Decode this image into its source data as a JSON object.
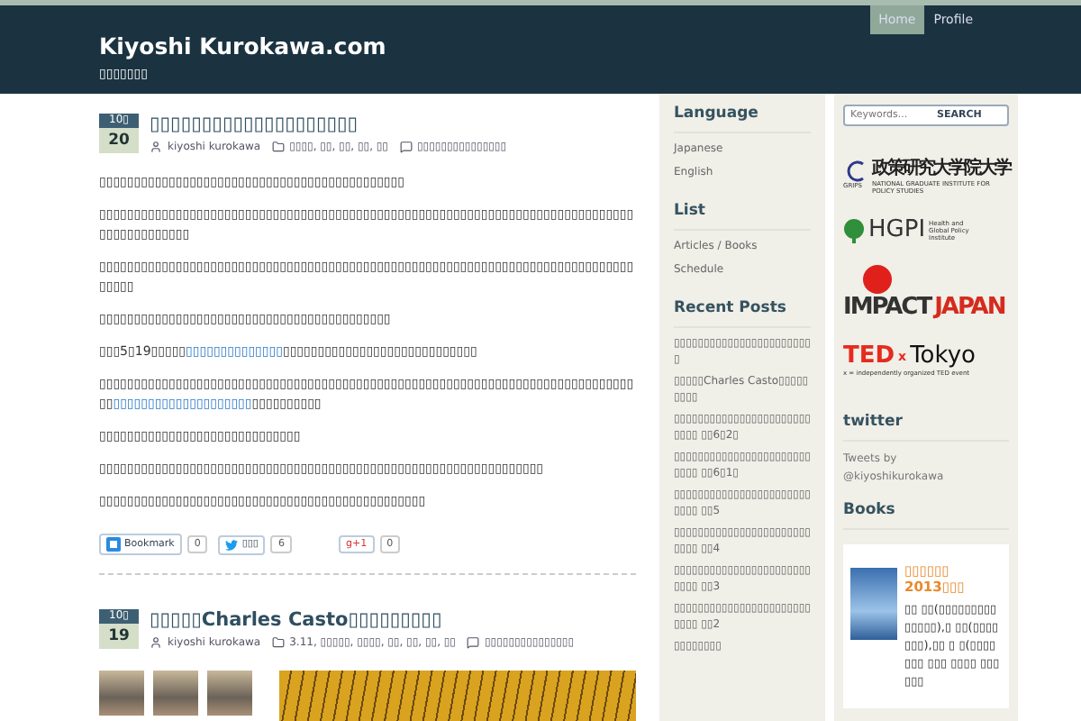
{
  "header": {
    "title": "Kiyoshi Kurokawa.com",
    "tagline": "▯▯▯▯▯▯▯"
  },
  "nav": [
    {
      "label": "Home",
      "selected": true
    },
    {
      "label": "Profile",
      "selected": false
    }
  ],
  "posts": [
    {
      "month": "10▯",
      "day": "20",
      "title": "▯▯▯▯▯▯▯▯▯▯▯▯▯▯▯▯▯▯▯▯",
      "author": "kiyoshi kurokawa",
      "categories": "▯▯▯▯, ▯▯, ▯▯, ▯▯, ▯▯",
      "comments": "▯▯▯▯▯▯▯▯▯▯▯▯▯▯▯",
      "paragraphs": [
        [
          {
            "text": "▯▯▯▯▯▯▯▯▯▯▯▯▯▯▯▯▯▯▯▯▯▯▯▯▯▯▯▯▯▯▯▯▯▯▯▯▯▯▯▯▯▯▯▯",
            "link": false
          }
        ],
        [
          {
            "text": "▯▯▯▯▯▯▯▯▯▯▯▯▯▯▯▯▯▯▯▯▯▯▯▯▯▯▯▯▯▯▯▯▯▯▯▯▯▯▯▯▯▯▯▯▯▯▯▯▯▯▯▯▯▯▯▯▯▯▯▯▯▯▯▯▯▯▯▯▯▯▯▯▯▯▯▯▯▯▯▯▯▯▯▯▯▯▯▯▯▯",
            "link": false
          }
        ],
        [
          {
            "text": "▯▯▯▯▯▯▯▯▯▯▯▯▯▯▯▯▯▯▯▯▯▯▯▯▯▯▯▯▯▯▯▯▯▯▯▯▯▯▯▯▯▯▯▯▯▯▯▯▯▯▯▯▯▯▯▯▯▯▯▯▯▯▯▯▯▯▯▯▯▯▯▯▯▯▯▯▯▯▯▯▯▯",
            "link": false
          }
        ],
        [
          {
            "text": "▯▯▯▯▯▯▯▯▯▯▯▯▯▯▯▯▯▯▯▯▯▯▯▯▯▯▯▯▯▯▯▯▯▯▯▯▯▯▯▯▯▯",
            "link": false
          }
        ],
        [
          {
            "text": "▯▯▯5▯19▯▯▯▯▯",
            "link": false
          },
          {
            "text": "▯▯▯▯▯▯▯▯▯▯▯▯▯▯",
            "link": true
          },
          {
            "text": "▯▯▯▯▯▯▯▯▯▯▯▯▯▯▯▯▯▯▯▯▯▯▯▯▯▯▯▯",
            "link": false
          }
        ],
        [
          {
            "text": "▯▯▯▯▯▯▯▯▯▯▯▯▯▯▯▯▯▯▯▯▯▯▯▯▯▯▯▯▯▯▯▯▯▯▯▯▯▯▯▯▯▯▯▯▯▯▯▯▯▯▯▯▯▯▯▯▯▯▯▯▯▯▯▯▯▯▯▯▯▯▯▯▯▯▯▯▯▯▯",
            "link": false
          },
          {
            "text": "▯▯▯▯▯▯▯▯▯▯▯▯▯▯▯▯▯▯▯▯",
            "link": true
          },
          {
            "text": "▯▯▯▯▯▯▯▯▯▯",
            "link": false
          }
        ],
        [
          {
            "text": "▯▯▯▯▯▯▯▯▯▯▯▯▯▯▯▯▯▯▯▯▯▯▯▯▯▯▯▯▯",
            "link": false
          }
        ],
        [
          {
            "text": "▯▯▯▯▯▯▯▯▯▯▯▯▯▯▯▯▯▯▯▯▯▯▯▯▯▯▯▯▯▯▯▯▯▯▯▯▯▯▯▯▯▯▯▯▯▯▯▯▯▯▯▯▯▯▯▯▯▯▯▯▯▯▯▯",
            "link": false
          }
        ],
        [
          {
            "text": "▯▯▯▯▯▯▯▯▯▯▯▯▯▯▯▯▯▯▯▯▯▯▯▯▯▯▯▯▯▯▯▯▯▯▯▯▯▯▯▯▯▯▯▯▯▯▯",
            "link": false
          }
        ]
      ],
      "share": [
        {
          "kind": "hatena",
          "label": "Bookmark",
          "count": "0"
        },
        {
          "kind": "twitter",
          "label": "▯▯▯",
          "count": "6"
        },
        {
          "kind": "gplus",
          "label": "g+1",
          "count": "0"
        }
      ]
    },
    {
      "month": "10▯",
      "day": "19",
      "title": "▯▯▯▯▯Charles Casto▯▯▯▯▯▯▯▯▯",
      "author": "kiyoshi kurokawa",
      "categories": "3.11, ▯▯▯▯▯, ▯▯▯▯, ▯▯, ▯▯, ▯▯, ▯▯",
      "comments": "▯▯▯▯▯▯▯▯▯▯▯▯▯▯▯",
      "photos": [
        {
          "kind": "thumb"
        },
        {
          "kind": "thumb"
        },
        {
          "kind": "thumb"
        },
        {
          "kind": "wide"
        }
      ]
    }
  ],
  "sidebar": [
    {
      "heading": "Language",
      "items": [
        "Japanese",
        "English"
      ]
    },
    {
      "heading": "List",
      "items": [
        "Articles / Books",
        "Schedule"
      ]
    },
    {
      "heading": "Recent Posts",
      "items": [
        "▯▯▯▯▯▯▯▯▯▯▯▯▯▯▯▯▯▯▯▯▯▯▯▯",
        "▯▯▯▯▯Charles Casto▯▯▯▯▯▯▯▯▯",
        "▯▯▯▯▯▯▯▯▯▯▯▯▯▯▯▯▯▯▯▯▯▯▯▯▯▯▯ ▯▯6▯2▯",
        "▯▯▯▯▯▯▯▯▯▯▯▯▯▯▯▯▯▯▯▯▯▯▯▯▯▯▯ ▯▯6▯1▯",
        "▯▯▯▯▯▯▯▯▯▯▯▯▯▯▯▯▯▯▯▯▯▯▯▯▯▯▯ ▯▯5",
        "▯▯▯▯▯▯▯▯▯▯▯▯▯▯▯▯▯▯▯▯▯▯▯▯▯▯▯ ▯▯4",
        "▯▯▯▯▯▯▯▯▯▯▯▯▯▯▯▯▯▯▯▯▯▯▯▯▯▯▯ ▯▯3",
        "▯▯▯▯▯▯▯▯▯▯▯▯▯▯▯▯▯▯▯▯▯▯▯▯▯▯▯ ▯▯2",
        "▯▯▯▯▯▯▯▯"
      ]
    }
  ],
  "search": {
    "placeholder": "Keywords...",
    "button": "SEARCH"
  },
  "logos": [
    {
      "kind": "grips",
      "mark": "GRIPS",
      "name": "政策研究大学院大学",
      "subtitle": "NATIONAL GRADUATE INSTITUTE FOR POLICY STUDIES"
    },
    {
      "kind": "hgpi",
      "mark": "HGPI",
      "name": "Health and Global Policy Institute"
    },
    {
      "kind": "impact",
      "mark": "IMPACT",
      "name": "JAPAN"
    },
    {
      "kind": "ted",
      "mark": "TED",
      "sup": "x",
      "name": "Tokyo",
      "subtitle": "x = independently organized TED event"
    }
  ],
  "twitter": {
    "heading": "twitter",
    "lines": [
      "Tweets by",
      "@kiyoshikurokawa"
    ]
  },
  "books": {
    "heading": "Books",
    "title": "▯▯▯▯▯▯ 2013▯▯▯",
    "description": "▯▯ ▯▯(▯▯▯▯▯▯▯▯▯▯▯▯▯▯),▯ ▯▯(▯▯▯▯▯▯▯),▯▯ ▯ ▯(▯▯▯▯▯▯▯ ▯▯▯ ▯▯▯▯ ▯▯▯▯▯▯"
  }
}
